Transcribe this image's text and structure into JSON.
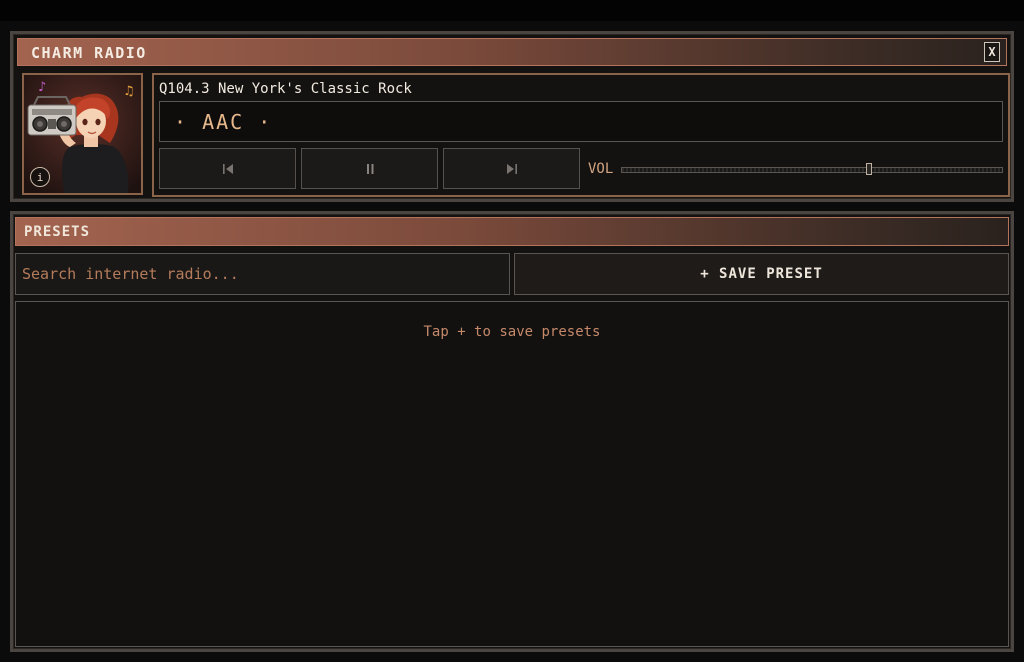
{
  "app": {
    "title": "CHARM RADIO",
    "close_label": "X"
  },
  "player": {
    "station_name": "Q104.3 New York's Classic Rock",
    "codec_display": "· AAC ·",
    "info_label": "i",
    "volume_label": "VOL",
    "volume_level": 0.65,
    "controls": [
      {
        "name": "previous-button",
        "icon": "skip-previous-icon"
      },
      {
        "name": "pause-button",
        "icon": "pause-icon"
      },
      {
        "name": "next-button",
        "icon": "skip-next-icon"
      }
    ]
  },
  "presets": {
    "title": "PRESETS",
    "search_placeholder": "Search internet radio...",
    "save_label": "+ SAVE PRESET",
    "empty_message": "Tap + to save presets"
  },
  "colors": {
    "accent": "#a3644f",
    "accent_text": "#c5896a",
    "codec_text": "#e6b88c",
    "border": "#8a6348",
    "background": "#141210"
  }
}
